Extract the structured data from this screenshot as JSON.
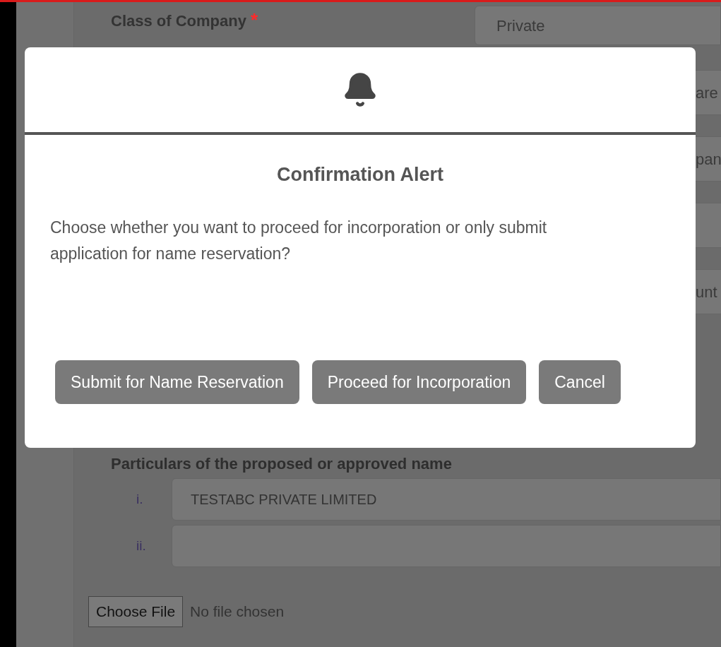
{
  "form": {
    "class_label": "Class of Company",
    "required_mark": "*",
    "class_value": "Private",
    "side_fields": [
      {
        "value": "are"
      },
      {
        "value": "pan"
      },
      {
        "value": "unt"
      }
    ],
    "names_heading": "Particulars of the proposed or approved name",
    "names": [
      {
        "index": "i.",
        "value": "TESTABC PRIVATE LIMITED"
      },
      {
        "index": "ii."
      }
    ],
    "file": {
      "button": "Choose File",
      "status": "No file chosen"
    }
  },
  "dialog": {
    "title": "Confirmation Alert",
    "message": "Choose whether you want to proceed for incorporation or only submit application for name reservation?",
    "buttons": [
      "Submit for Name Reservation",
      "Proceed for Incorporation",
      "Cancel"
    ]
  }
}
